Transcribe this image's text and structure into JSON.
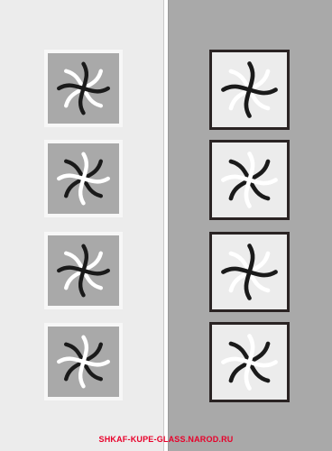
{
  "caption": "SHKAF-KUPE-GLASS.NAROD.RU",
  "colors": {
    "left_panel": "#ececec",
    "right_panel": "#a9a9a9",
    "dark": "#1a1a1a",
    "light": "#ffffff",
    "accent": "#e8002a"
  },
  "left_column": [
    {
      "frame": "light",
      "fill": "gray",
      "motif": "pinwheel-icon",
      "front": "dark",
      "back": "light"
    },
    {
      "frame": "light",
      "fill": "gray",
      "motif": "pinwheel-icon",
      "front": "light",
      "back": "dark"
    },
    {
      "frame": "light",
      "fill": "gray",
      "motif": "pinwheel-icon",
      "front": "dark",
      "back": "light"
    },
    {
      "frame": "light",
      "fill": "gray",
      "motif": "pinwheel-icon",
      "front": "light",
      "back": "dark"
    }
  ],
  "right_column": [
    {
      "frame": "dark",
      "fill": "light",
      "motif": "pinwheel-icon",
      "front": "dark",
      "back": "light"
    },
    {
      "frame": "dark",
      "fill": "light",
      "motif": "pinwheel-icon",
      "front": "light",
      "back": "dark"
    },
    {
      "frame": "dark",
      "fill": "light",
      "motif": "pinwheel-icon",
      "front": "dark",
      "back": "light"
    },
    {
      "frame": "dark",
      "fill": "light",
      "motif": "pinwheel-icon",
      "front": "light",
      "back": "dark"
    }
  ]
}
